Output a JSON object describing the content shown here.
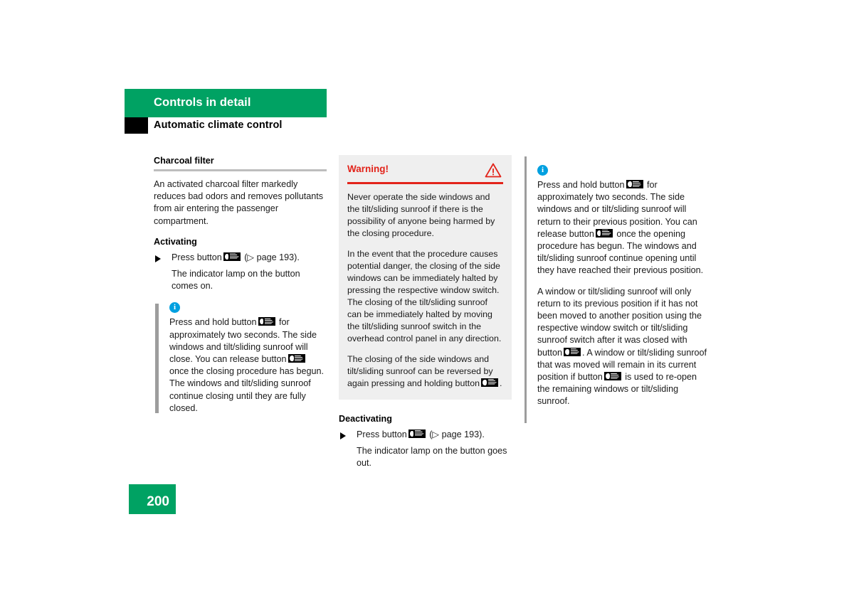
{
  "header": {
    "chapter": "Controls in detail",
    "section": "Automatic climate control"
  },
  "page_number": "200",
  "icons": {
    "info": "i",
    "warning_triangle": "warning-triangle-icon",
    "button_close": "window-close-button-icon",
    "button_open": "window-open-button-icon"
  },
  "column1": {
    "title": "Charcoal filter",
    "intro": "An activated charcoal filter markedly reduces bad odors and removes pollutants from air entering the passenger compartment.",
    "activating_heading": "Activating",
    "step_prefix": "Press button",
    "step_suffix": "(▷ page 193).",
    "step_result": "The indicator lamp on the button comes on.",
    "note": {
      "part1": "Press and hold button",
      "part2": "for approximately two seconds. The side windows and tilt/sliding sunroof will close. You can release button",
      "part3": "once the closing procedure has begun. The windows and tilt/sliding sunroof continue closing until they are fully closed."
    }
  },
  "column2": {
    "warning": {
      "title": "Warning!",
      "paragraph1": "Never operate the side windows and the tilt/sliding sunroof if there is the possibility of anyone being harmed by the closing procedure.",
      "paragraph2": "In the event that the procedure causes potential danger, the closing of the side windows can be immediately halted by pressing the respective window switch. The closing of the tilt/sliding sunroof can be immediately halted by moving the tilt/sliding sunroof switch in the overhead control panel in any direction.",
      "paragraph3_part1": "The closing of the side windows and tilt/sliding sunroof can be reversed by again pressing and holding button",
      "paragraph3_part2": "."
    },
    "deactivating_heading": "Deactivating",
    "step_prefix": "Press button",
    "step_suffix": "(▷ page 193).",
    "step_result": "The indicator lamp on the button goes out."
  },
  "column3": {
    "note": {
      "part1": "Press and hold button",
      "part2": "for approximately two seconds. The side windows and or tilt/sliding sunroof will return to their previous position. You can release button",
      "part3": "once the opening procedure has begun. The windows and tilt/sliding sunroof continue opening until they have reached their previous position."
    },
    "paragraph": {
      "part1": "A window or tilt/sliding sunroof will only return to its previous position if it has not been moved to another position using the respective window switch or tilt/sliding sunroof switch after it was closed with button",
      "part2": ". A window or tilt/sliding sunroof that was moved will remain in its current position if button",
      "part3": "is used to re-open the remaining windows or tilt/sliding sunroof."
    }
  },
  "colors": {
    "green": "#00a263",
    "warning_red": "#e2231a",
    "info_blue": "#00a0e0",
    "gray_bar": "#9d9d9d",
    "warning_bg": "#efefef"
  }
}
